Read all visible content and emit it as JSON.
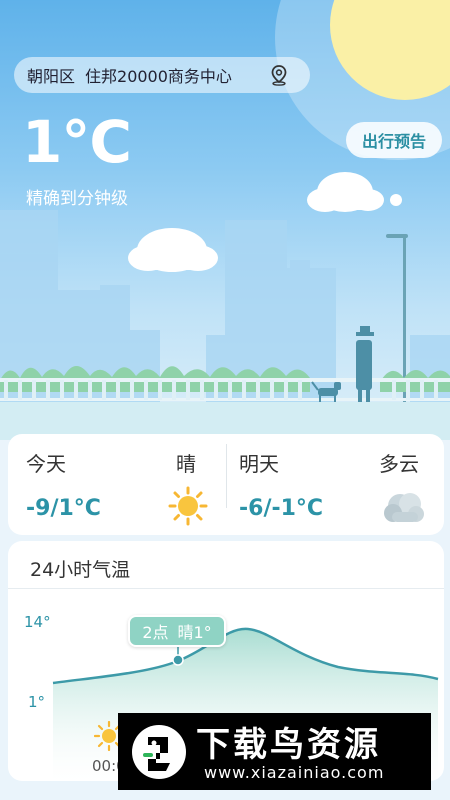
{
  "header": {
    "district": "朝阳区",
    "address": "住邦20000商务中心",
    "location_icon": "location-pin-icon"
  },
  "current": {
    "temperature": "1°C",
    "accuracy_note": "精确到分钟级",
    "trip_button": "出行预告"
  },
  "forecast": [
    {
      "day": "今天",
      "condition": "晴",
      "range": "-9/1°C",
      "icon": "sunny-icon"
    },
    {
      "day": "明天",
      "condition": "多云",
      "range": "-6/-1°C",
      "icon": "cloudy-icon"
    }
  ],
  "hourly": {
    "title": "24小时气温",
    "max_label": "14°",
    "min_label": "1°",
    "tooltip_time": "2点",
    "tooltip_cond": "晴1°",
    "first_hour": "00:0",
    "icon": "sunny-icon"
  },
  "watermark": {
    "title": "下载鸟资源",
    "url": "www.xiazainiao.com"
  },
  "colors": {
    "accent": "#2c93a7",
    "sky_top": "#5fb2ea",
    "sun": "#faf0a6",
    "curve_fill": "#bfe6dd"
  }
}
